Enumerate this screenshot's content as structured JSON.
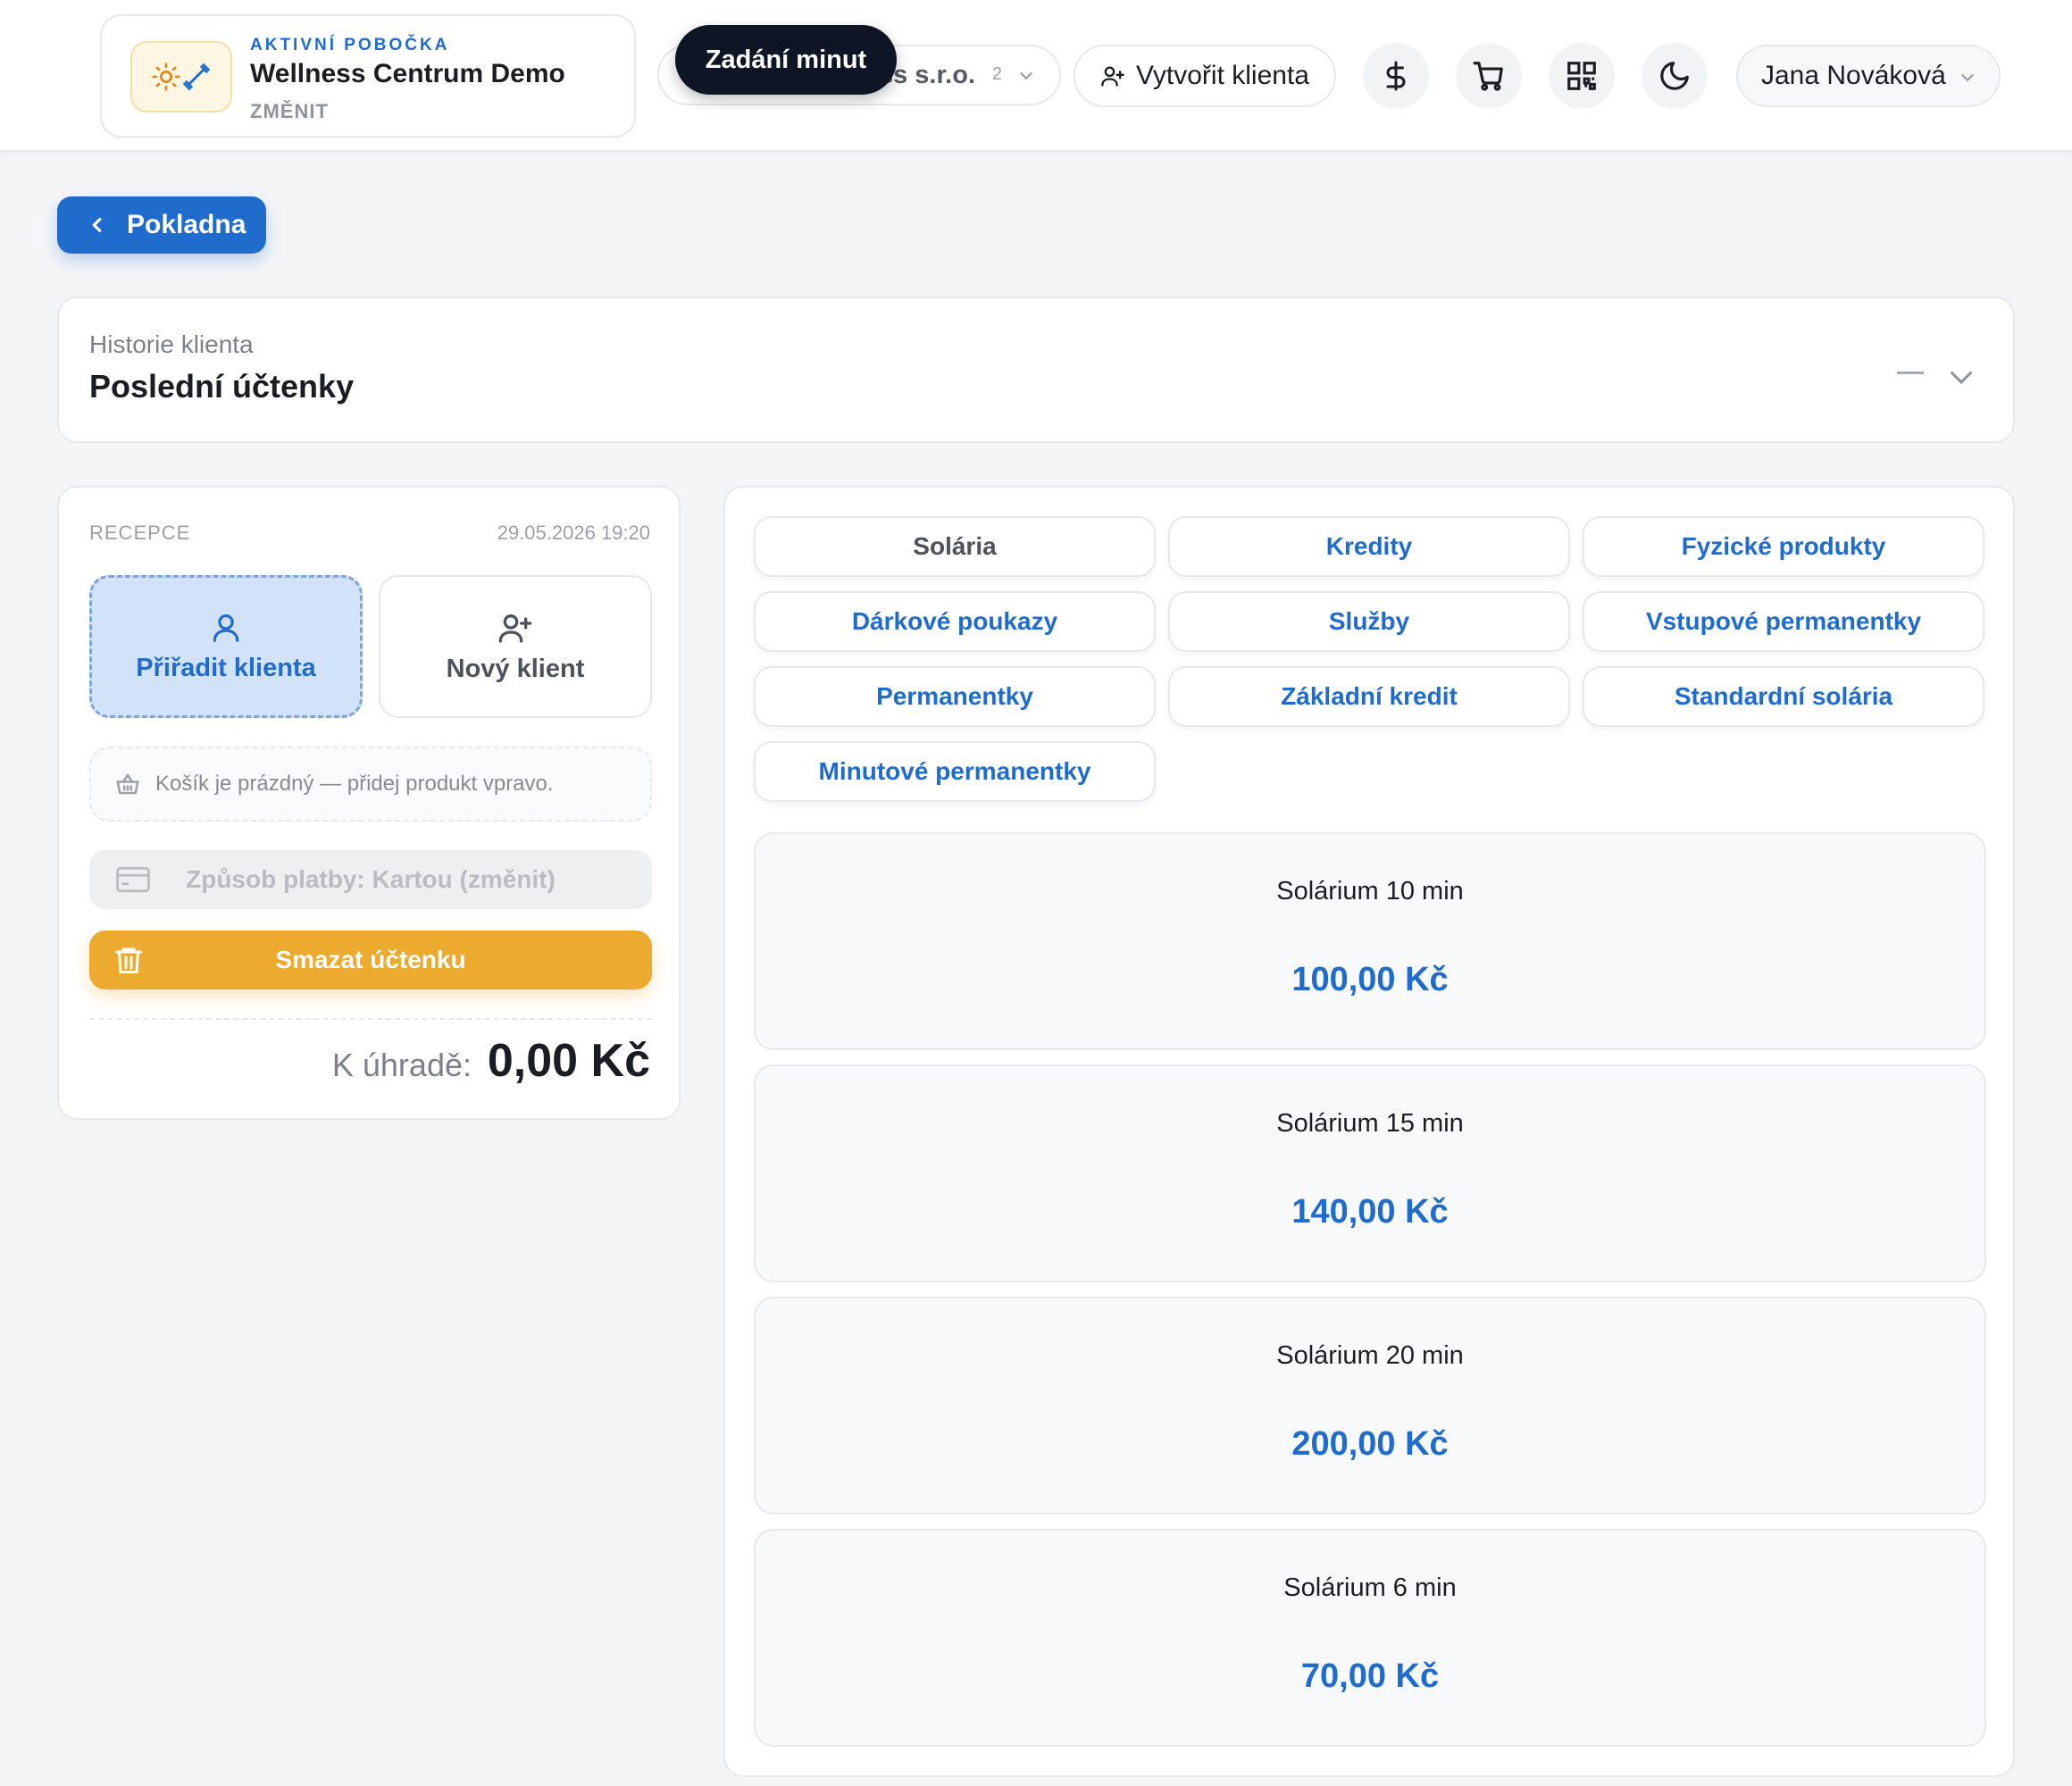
{
  "header": {
    "branch": {
      "eyebrow": "AKTIVNÍ POBOČKA",
      "name": "Wellness Centrum Demo",
      "change_label": "ZMĚNIT"
    },
    "company_select": {
      "value": "ss s.r.o.",
      "count": "2"
    },
    "tooltip": "Zadání minut",
    "create_client_label": "Vytvořit klienta",
    "icons": [
      "dollar-icon",
      "cart-icon",
      "qr-code-icon",
      "moon-icon"
    ],
    "user_name": "Jana Nováková"
  },
  "back_button_label": "Pokladna",
  "history": {
    "eyebrow": "Historie klienta",
    "title": "Poslední účtenky"
  },
  "receipt": {
    "label": "RECEPCE",
    "date": "29.05.2026 19:20",
    "assign_client_label": "Přiřadit klienta",
    "new_client_label": "Nový klient",
    "cart_empty_text": "Košík je prázdný — přidej produkt vpravo.",
    "payment_method_label": "Způsob platby: Kartou (změnit)",
    "delete_label": "Smazat účtenku",
    "total_label": "K úhradě:",
    "total_value": "0,00 Kč"
  },
  "categories": [
    {
      "label": "Solária",
      "active": true
    },
    {
      "label": "Kredity",
      "active": false
    },
    {
      "label": "Fyzické produkty",
      "active": false
    },
    {
      "label": "Dárkové poukazy",
      "active": false
    },
    {
      "label": "Služby",
      "active": false
    },
    {
      "label": "Vstupové permanentky",
      "active": false
    },
    {
      "label": "Permanentky",
      "active": false
    },
    {
      "label": "Základní kredit",
      "active": false
    },
    {
      "label": "Standardní solária",
      "active": false
    },
    {
      "label": "Minutové permanentky",
      "active": false
    }
  ],
  "products": [
    {
      "name": "Solárium 10 min",
      "price": "100,00 Kč"
    },
    {
      "name": "Solárium 15 min",
      "price": "140,00 Kč"
    },
    {
      "name": "Solárium 20 min",
      "price": "200,00 Kč"
    },
    {
      "name": "Solárium 6 min",
      "price": "70,00 Kč"
    }
  ],
  "colors": {
    "accent": "#1f6ccc",
    "warning": "#ecaa2f",
    "tooltip_bg": "#0e1525"
  }
}
